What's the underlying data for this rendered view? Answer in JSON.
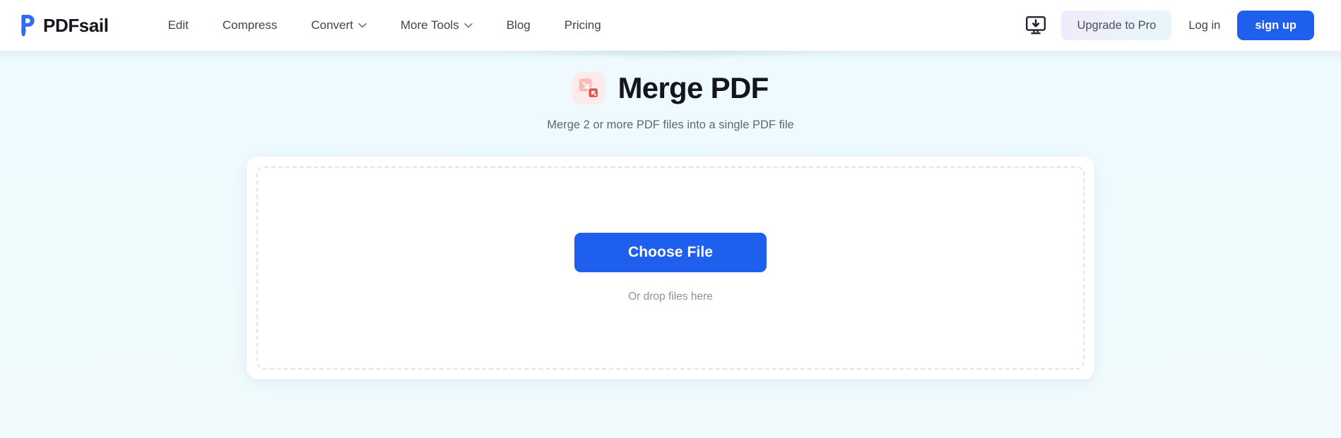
{
  "brand": {
    "name": "PDFsail",
    "logo_icon": "pdfsail-sailboat-p-logo",
    "logo_color": "#2f6df0"
  },
  "header": {
    "nav": [
      {
        "label": "Edit",
        "has_dropdown": false
      },
      {
        "label": "Compress",
        "has_dropdown": false
      },
      {
        "label": "Convert",
        "has_dropdown": true
      },
      {
        "label": "More Tools",
        "has_dropdown": true
      },
      {
        "label": "Blog",
        "has_dropdown": false
      },
      {
        "label": "Pricing",
        "has_dropdown": false
      }
    ],
    "desktop_app_icon": "monitor-download-icon",
    "upgrade_label": "Upgrade to Pro",
    "login_label": "Log in",
    "signup_label": "sign up",
    "signup_color": "#1f5fee"
  },
  "main": {
    "tool_icon": "merge-pdf-icon",
    "tool_icon_colors": {
      "badge_background": "#fdeaea",
      "square_light": "#fbb9b9",
      "square_dark": "#ef5350"
    },
    "title": "Merge PDF",
    "subtitle": "Merge 2 or more PDF files into a single PDF file",
    "upload": {
      "choose_file_label": "Choose File",
      "drop_hint": "Or drop files here",
      "button_color": "#1f5fee",
      "dropzone_border_color": "#e2e4ea"
    }
  },
  "theme": {
    "page_background": "#f0fbff",
    "header_background": "#ffffff",
    "text_primary": "#14161d",
    "text_secondary": "#5d6673"
  }
}
